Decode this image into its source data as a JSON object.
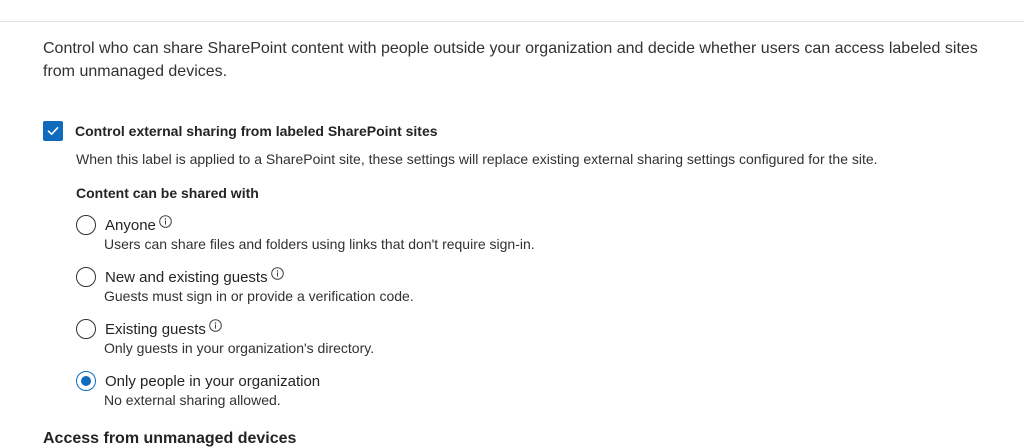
{
  "intro_text": "Control who can share SharePoint content with people outside your organization and decide whether users can access labeled sites from unmanaged devices.",
  "external_sharing": {
    "checkbox_label": "Control external sharing from labeled SharePoint sites",
    "checked": true,
    "description": "When this label is applied to a SharePoint site, these settings will replace existing external sharing settings configured for the site."
  },
  "sharing_options": {
    "heading": "Content can be shared with",
    "options": [
      {
        "label": "Anyone",
        "description": "Users can share files and folders using links that don't require sign-in.",
        "info": true,
        "selected": false
      },
      {
        "label": "New and existing guests",
        "description": "Guests must sign in or provide a verification code.",
        "info": true,
        "selected": false
      },
      {
        "label": "Existing guests",
        "description": "Only guests in your organization's directory.",
        "info": true,
        "selected": false
      },
      {
        "label": "Only people in your organization",
        "description": "No external sharing allowed.",
        "info": false,
        "selected": true
      }
    ]
  },
  "next_section_heading": "Access from unmanaged devices",
  "colors": {
    "accent": "#0f6cbd",
    "text": "#242424",
    "divider": "#e1e1e1"
  },
  "icons": {
    "checkbox": "checkmark-icon",
    "info": "info-icon"
  }
}
